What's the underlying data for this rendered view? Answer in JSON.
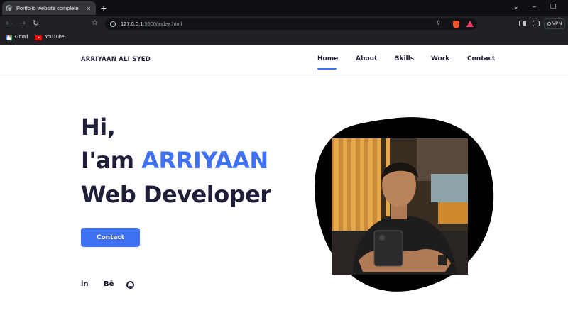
{
  "browser": {
    "tab_title": "Portfolio website complete",
    "tab_close": "×",
    "new_tab": "+",
    "url_host": "127.0.0.1",
    "url_path": ":5500/index.html",
    "vpn_label": "VPN",
    "nav_back": "←",
    "nav_forward": "→",
    "nav_reload": "↻",
    "bookmark_star": "☆",
    "share": "⇪",
    "win_chevron": "⌄",
    "win_minimize": "–",
    "win_restore": "❐",
    "bookmarks": [
      {
        "label": "Gmail",
        "icon": "gmail-icon"
      },
      {
        "label": "YouTube",
        "icon": "youtube-icon"
      }
    ]
  },
  "site": {
    "logo": "ARRIYAAN ALI SYED",
    "nav": [
      {
        "label": "Home",
        "active": true
      },
      {
        "label": "About"
      },
      {
        "label": "Skills"
      },
      {
        "label": "Work"
      },
      {
        "label": "Contact"
      }
    ]
  },
  "hero": {
    "line1": "Hi,",
    "line2_prefix": "I'am ",
    "line2_name": "ARRIYAAN",
    "line3": "Web Developer",
    "button": "Contact",
    "social": [
      {
        "label": "in",
        "icon": "linkedin-icon"
      },
      {
        "label": "Bē",
        "icon": "behance-icon"
      },
      {
        "label": "",
        "icon": "github-icon"
      }
    ]
  },
  "colors": {
    "accent": "#4070f4",
    "text_dark": "#1f1f3a",
    "blob": "#000000"
  }
}
